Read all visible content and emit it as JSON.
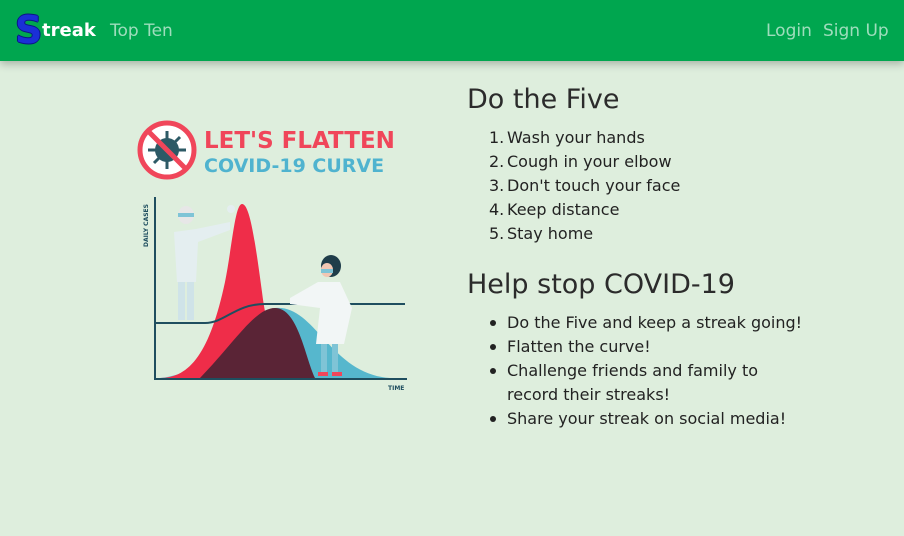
{
  "navbar": {
    "brand_initial": "S",
    "brand_rest": "treak",
    "top_ten": "Top Ten",
    "login": "Login",
    "signup": "Sign Up",
    "bg_color": "#00a64f"
  },
  "poster": {
    "line1": "LET'S FLATTEN",
    "line2": "COVID-19 CURVE",
    "y_axis_label": "DAILY CASES",
    "x_axis_label": "TIME"
  },
  "do_five": {
    "title": "Do the Five",
    "items": [
      {
        "num": "1.",
        "text": "Wash your hands"
      },
      {
        "num": "2.",
        "text": "Cough in your elbow"
      },
      {
        "num": "3.",
        "text": "Don't touch your face"
      },
      {
        "num": "4.",
        "text": "Keep distance"
      },
      {
        "num": "5.",
        "text": "Stay home"
      }
    ]
  },
  "help": {
    "title": "Help stop COVID-19",
    "items": [
      "Do the Five and keep a streak going!",
      "Flatten the curve!",
      "Challenge friends and family to record their streaks!",
      "Share your streak on social media!"
    ]
  }
}
